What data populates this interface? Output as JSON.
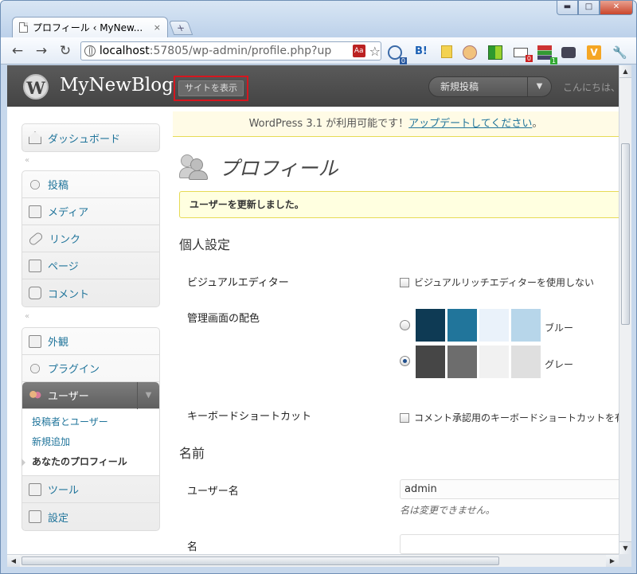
{
  "browser": {
    "tab_title": "プロフィール ‹ MyNew...",
    "tab_close": "×",
    "new_tab": "+",
    "url_host": "localhost",
    "url_path": ":57805/wp-admin/profile.php?up",
    "omnibox_badge": "Aa",
    "star": "☆",
    "back": "←",
    "forward": "→",
    "reload": "↻",
    "win_min": "▬",
    "win_max": "□",
    "win_close": "✕",
    "ext_b": "B!",
    "ext_v": "V",
    "ext_wrench": "🔧"
  },
  "header": {
    "logo_letter": "W",
    "blog_name": "MyNewBlog",
    "visit_site": "サイトを表示",
    "new_post": "新規投稿",
    "new_post_arrow": "▼",
    "greeting": "こんにちは、"
  },
  "sidebar": {
    "dashboard": "ダッシュボード",
    "separator": "«",
    "posts": "投稿",
    "media": "メディア",
    "links": "リンク",
    "pages": "ページ",
    "comments": "コメント",
    "appearance": "外観",
    "plugins": "プラグイン",
    "users": "ユーザー",
    "users_arrow": "▼",
    "users_sub": [
      "投稿者とユーザー",
      "新規追加",
      "あなたのプロフィール"
    ],
    "tools": "ツール",
    "settings": "設定"
  },
  "nag": {
    "prefix": "WordPress 3.1 が利用可能です！",
    "link": "アップデートしてください",
    "suffix": "。"
  },
  "main": {
    "title": "プロフィール",
    "notice": "ユーザーを更新しました。",
    "personal_heading": "個人設定",
    "visual_editor_label": "ビジュアルエディター",
    "visual_editor_checkbox": "ビジュアルリッチエディターを使用しない",
    "color_scheme_label": "管理画面の配色",
    "schemes": [
      {
        "name": "ブルー",
        "colors": [
          "#0e3a54",
          "#21759b",
          "#eaf2fa",
          "#b7d6ea"
        ],
        "selected": false
      },
      {
        "name": "グレー",
        "colors": [
          "#464646",
          "#6d6d6d",
          "#f1f1f1",
          "#dfdfdf"
        ],
        "selected": true
      }
    ],
    "keyboard_label": "キーボードショートカット",
    "keyboard_checkbox": "コメント承認用のキーボードショートカットを有効",
    "name_heading": "名前",
    "username_label": "ユーザー名",
    "username_value": "admin",
    "username_desc": "名は変更できません。",
    "firstname_label": "名",
    "firstname_value": ""
  },
  "scroll": {
    "up": "▲",
    "down": "▼",
    "left": "◀",
    "right": "▶"
  }
}
